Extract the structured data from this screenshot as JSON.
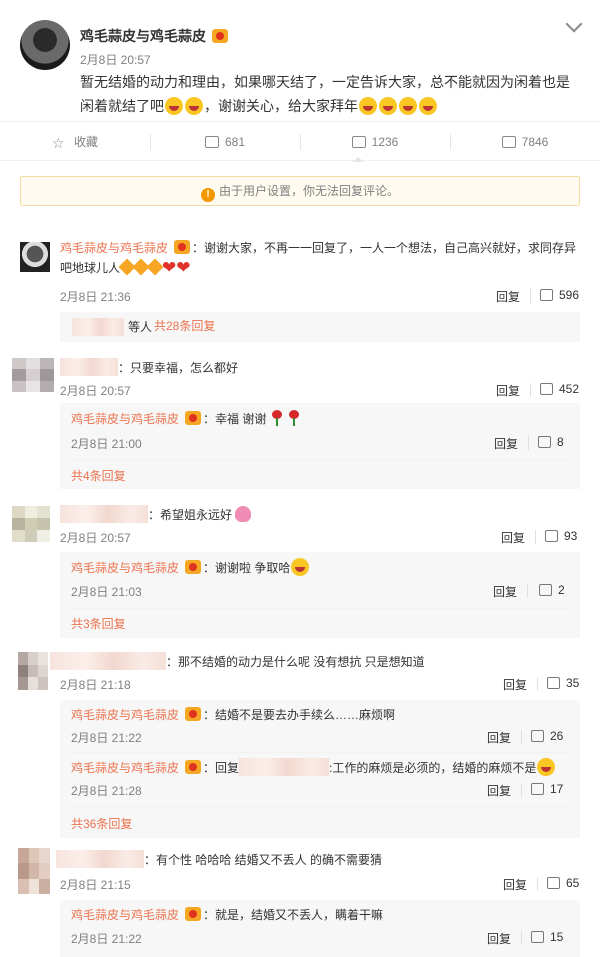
{
  "post": {
    "author": "鸡毛蒜皮与鸡毛蒜皮",
    "time": "2月8日 20:57",
    "text_line1": "暂无结婚的动力和理由，如果哪天结了，一定告诉大家，总不能就因为闲着也是",
    "text_line2": "闲着就结了吧",
    "text_line2b": "，谢谢关心，给大家拜年"
  },
  "actions": {
    "favorite": "收藏",
    "repost": "681",
    "comment": "1236",
    "like": "7846"
  },
  "notice": "由于用户设置，你无法回复评论。",
  "comments": [
    {
      "author": "鸡毛蒜皮与鸡毛蒜皮",
      "text1": "：谢谢大家，不再一一回复了，一人一个想法，自己高兴就好，求同存异",
      "text2": "吧地球儿人",
      "time": "2月8日 21:36",
      "reply": "回复",
      "likes": "596",
      "sub_tail": "等人",
      "sub_more": "共28条回复"
    },
    {
      "text": "：只要幸福，怎么都好",
      "time": "2月8日 20:57",
      "reply": "回复",
      "likes": "452",
      "sub": {
        "author": "鸡毛蒜皮与鸡毛蒜皮",
        "text": "：幸福 谢谢",
        "time": "2月8日 21:00",
        "reply": "回复",
        "likes": "8"
      },
      "more": "共4条回复"
    },
    {
      "text": "：希望姐永远好",
      "time": "2月8日 20:57",
      "reply": "回复",
      "likes": "93",
      "sub": {
        "author": "鸡毛蒜皮与鸡毛蒜皮",
        "text": "：谢谢啦 争取哈",
        "time": "2月8日 21:03",
        "reply": "回复",
        "likes": "2"
      },
      "more": "共3条回复"
    },
    {
      "text": "：那不结婚的动力是什么呢 没有想抗 只是想知道",
      "time": "2月8日 21:18",
      "reply": "回复",
      "likes": "35",
      "sub1": {
        "author": "鸡毛蒜皮与鸡毛蒜皮",
        "text": "：结婚不是要去办手续么……麻烦啊",
        "time": "2月8日 21:22",
        "reply": "回复",
        "likes": "26"
      },
      "sub2": {
        "author": "鸡毛蒜皮与鸡毛蒜皮",
        "text_pre": "：回复",
        "text_post": ":工作的麻烦是必须的，结婚的麻烦不是",
        "time": "2月8日 21:28",
        "reply": "回复",
        "likes": "17"
      },
      "more": "共36条回复"
    },
    {
      "text": "：有个性 哈哈哈 结婚又不丢人 的确不需要猜",
      "time": "2月8日 21:15",
      "reply": "回复",
      "likes": "65",
      "sub": {
        "author": "鸡毛蒜皮与鸡毛蒜皮",
        "text": "：就是，结婚又不丢人，瞒着干嘛",
        "time": "2月8日 21:22",
        "reply": "回复",
        "likes": "15"
      }
    }
  ],
  "icons": [
    "chevron-down-icon",
    "star-icon",
    "repost-icon",
    "comment-icon",
    "like-icon",
    "warning-icon",
    "vip-icon"
  ]
}
